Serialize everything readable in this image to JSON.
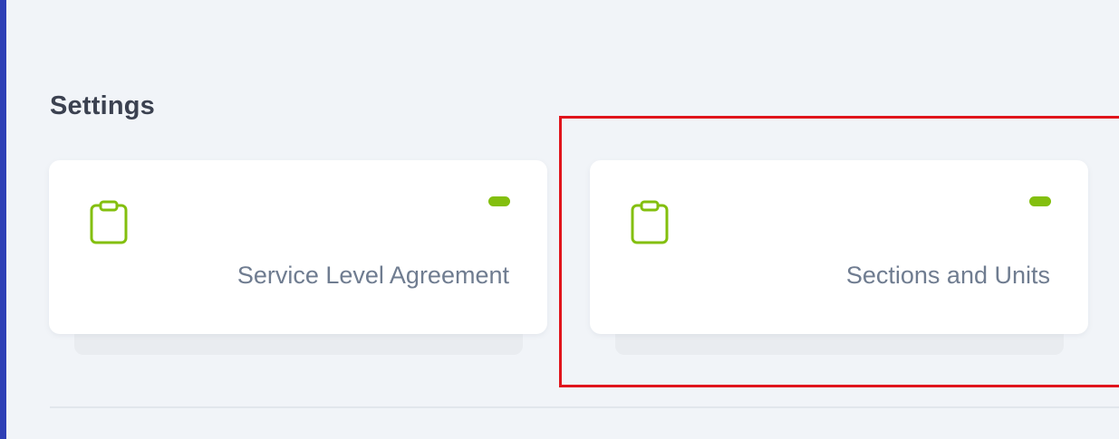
{
  "page": {
    "title": "Settings"
  },
  "cards": [
    {
      "label": "Service Level Agreement",
      "icon": "clipboard-icon",
      "status_color": "#83bf0e"
    },
    {
      "label": "Sections and Units",
      "icon": "clipboard-icon",
      "status_color": "#83bf0e"
    }
  ],
  "colors": {
    "accent_left_bar": "#2e3fb6",
    "icon_green": "#83bf0e",
    "highlight_red": "#e0141c",
    "background": "#f1f4f8"
  }
}
